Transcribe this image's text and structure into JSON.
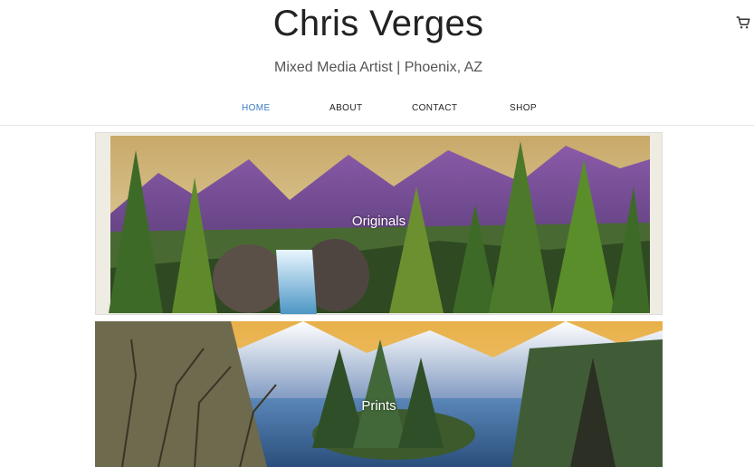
{
  "header": {
    "title": "Chris Verges",
    "tagline": "Mixed Media Artist | Phoenix, AZ",
    "cart_icon": "shopping-cart-icon"
  },
  "nav": {
    "items": [
      {
        "label": "HOME",
        "active": true
      },
      {
        "label": "ABOUT",
        "active": false
      },
      {
        "label": "CONTACT",
        "active": false
      },
      {
        "label": "SHOP",
        "active": false
      }
    ],
    "active_color": "#3a7bc8"
  },
  "gallery": {
    "tiles": [
      {
        "label": "Originals"
      },
      {
        "label": "Prints"
      }
    ]
  }
}
